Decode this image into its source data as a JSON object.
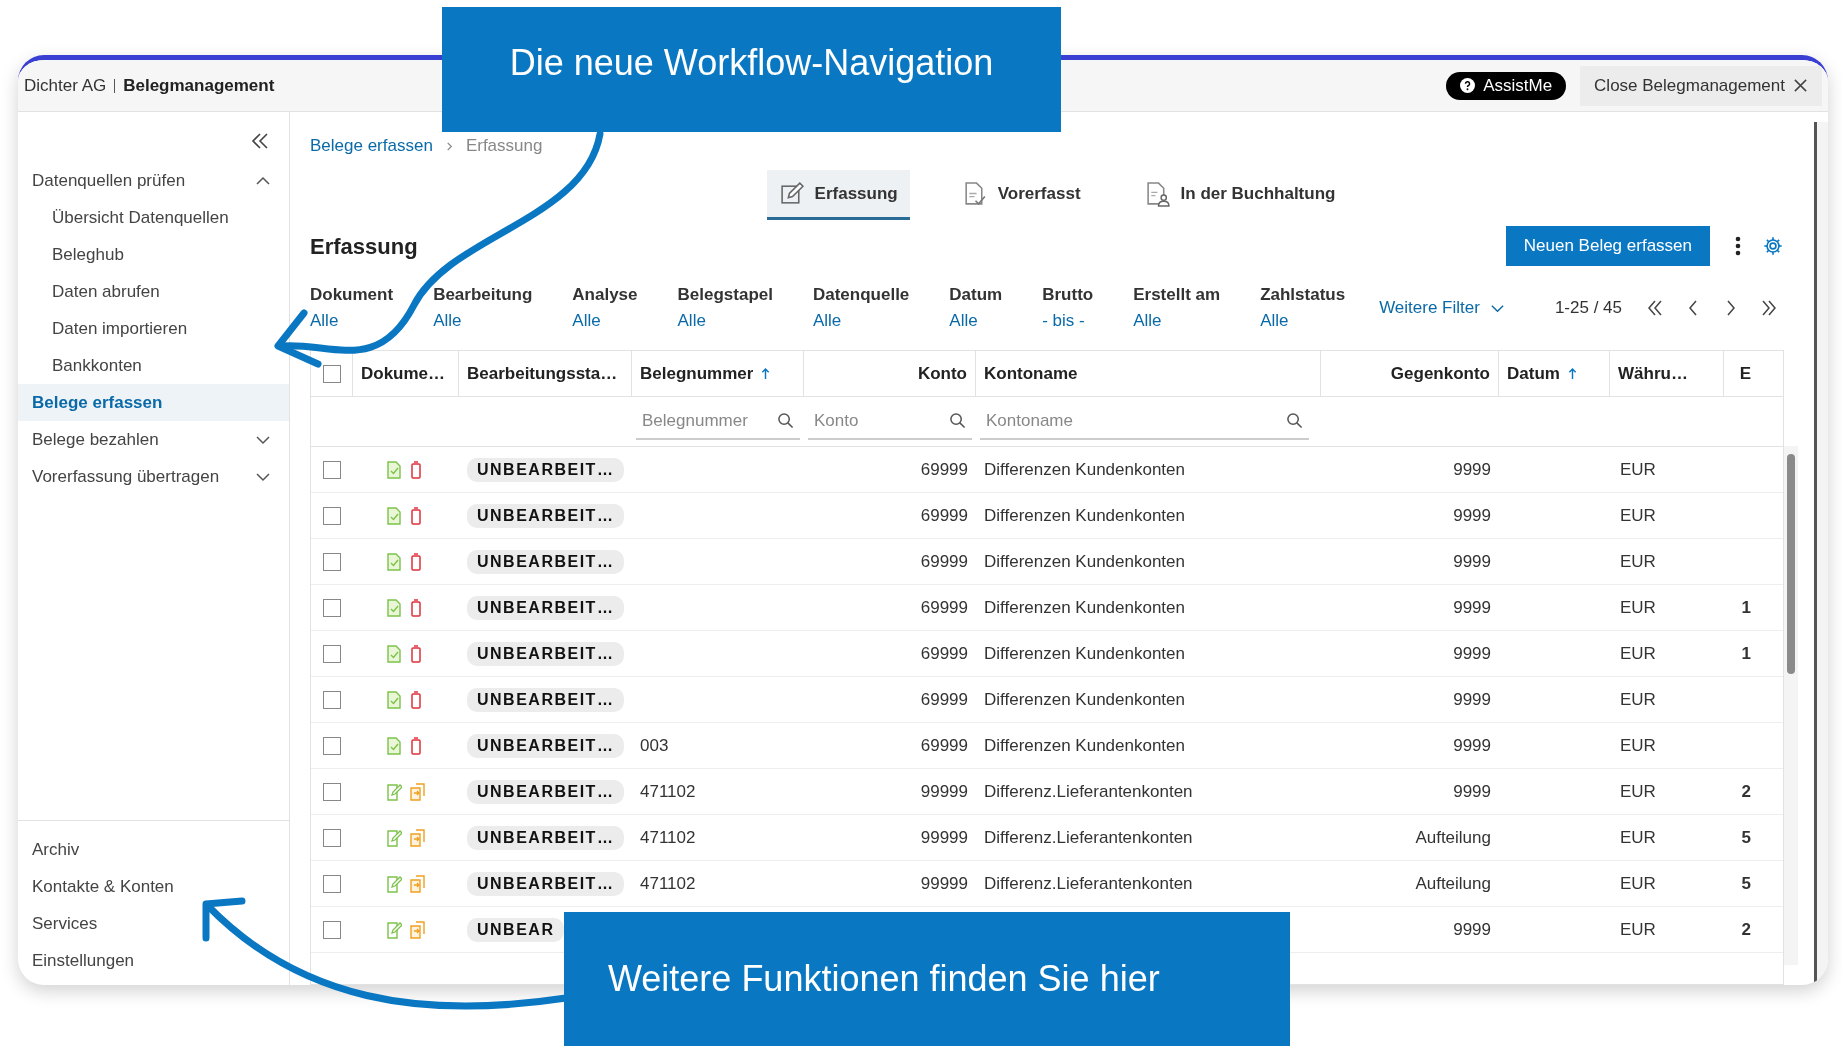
{
  "header": {
    "company": "Dichter AG",
    "app_title": "Belegmanagement",
    "assist_button": "AssistMe",
    "close_button": "Close Belegmanagement"
  },
  "sidebar": {
    "items": [
      {
        "label": "Datenquellen prüfen",
        "selected": false,
        "expanded": true,
        "children": [
          {
            "label": "Übersicht Datenquellen",
            "selected": false
          },
          {
            "label": "Beleghub",
            "selected": false
          },
          {
            "label": "Daten abrufen",
            "selected": false
          },
          {
            "label": "Daten importieren",
            "selected": false
          },
          {
            "label": "Bankkonten",
            "selected": false
          }
        ]
      },
      {
        "label": "Belege erfassen",
        "selected": true
      },
      {
        "label": "Belege bezahlen",
        "selected": false,
        "expanded": false
      },
      {
        "label": "Vorerfassung übertragen",
        "selected": false,
        "expanded": false
      }
    ],
    "bottom_items": [
      "Archiv",
      "Kontakte & Konten",
      "Services",
      "Einstellungen"
    ]
  },
  "breadcrumb": [
    "Belege erfassen",
    "Erfassung"
  ],
  "tabs": [
    {
      "label": "Erfassung",
      "selected": true,
      "kind": "edit"
    },
    {
      "label": "Vorerfasst",
      "selected": false,
      "kind": "check"
    },
    {
      "label": "In der Buchhaltung",
      "selected": false,
      "kind": "person"
    }
  ],
  "page_title": "Erfassung",
  "primary_button": "Neuen Beleg erfassen",
  "filters": [
    {
      "label": "Dokument",
      "value": "Alle"
    },
    {
      "label": "Bearbeitung",
      "value": "Alle"
    },
    {
      "label": "Analyse",
      "value": "Alle"
    },
    {
      "label": "Belegstapel",
      "value": "Alle"
    },
    {
      "label": "Datenquelle",
      "value": "Alle"
    },
    {
      "label": "Datum",
      "value": "Alle"
    },
    {
      "label": "Brutto",
      "value": "- bis -"
    },
    {
      "label": "Erstellt am",
      "value": "Alle"
    },
    {
      "label": "Zahlstatus",
      "value": "Alle"
    }
  ],
  "more_filters": "Weitere Filter",
  "pagination": "1-25 / 45",
  "table": {
    "select_all": {
      "checked": false
    },
    "columns": [
      {
        "label": "Dokume…",
        "sorted": false
      },
      {
        "label": "Bearbeitungssta…",
        "sorted": false
      },
      {
        "label": "Belegnummer",
        "sorted": true
      },
      {
        "label": "Konto",
        "sorted": false
      },
      {
        "label": "Kontoname",
        "sorted": false
      },
      {
        "label": "Gegenkonto",
        "sorted": false
      },
      {
        "label": "Datum",
        "sorted": true
      },
      {
        "label": "Währu…",
        "sorted": false
      },
      {
        "label": "E",
        "sorted": false
      }
    ],
    "search_fields": [
      {
        "placeholder": "Belegnummer"
      },
      {
        "placeholder": "Konto"
      },
      {
        "placeholder": "Kontoname"
      }
    ],
    "rows": [
      {
        "checked": false,
        "kind": "upload",
        "status": "UNBEARBEIT…",
        "konto": "69999",
        "kontoname": "Differenzen Kundenkonten",
        "gegenkonto": "9999",
        "currency": "EUR"
      },
      {
        "checked": false,
        "kind": "upload",
        "status": "UNBEARBEIT…",
        "konto": "69999",
        "kontoname": "Differenzen Kundenkonten",
        "gegenkonto": "9999",
        "currency": "EUR"
      },
      {
        "checked": false,
        "kind": "upload",
        "status": "UNBEARBEIT…",
        "konto": "69999",
        "kontoname": "Differenzen Kundenkonten",
        "gegenkonto": "9999",
        "currency": "EUR"
      },
      {
        "checked": false,
        "kind": "upload",
        "status": "UNBEARBEIT…",
        "konto": "69999",
        "kontoname": "Differenzen Kundenkonten",
        "gegenkonto": "9999",
        "currency": "EUR",
        "column_10": "1"
      },
      {
        "checked": false,
        "kind": "upload",
        "status": "UNBEARBEIT…",
        "konto": "69999",
        "kontoname": "Differenzen Kundenkonten",
        "gegenkonto": "9999",
        "currency": "EUR",
        "column_10": "1"
      },
      {
        "checked": false,
        "kind": "upload",
        "status": "UNBEARBEIT…",
        "konto": "69999",
        "kontoname": "Differenzen Kundenkonten",
        "gegenkonto": "9999",
        "currency": "EUR"
      },
      {
        "checked": false,
        "kind": "upload",
        "status": "UNBEARBEIT…",
        "belegnummer": "003",
        "konto": "69999",
        "kontoname": "Differenzen Kundenkonten",
        "gegenkonto": "9999",
        "currency": "EUR"
      },
      {
        "checked": false,
        "kind": "edit",
        "status": "UNBEARBEIT…",
        "belegnummer": "471102",
        "konto": "99999",
        "kontoname": "Differenz.Lieferantenkonten",
        "gegenkonto": "9999",
        "currency": "EUR",
        "column_10": "2"
      },
      {
        "checked": false,
        "kind": "edit",
        "status": "UNBEARBEIT…",
        "belegnummer": "471102",
        "konto": "99999",
        "kontoname": "Differenz.Lieferantenkonten",
        "gegenkonto": "Aufteilung",
        "currency": "EUR",
        "column_10": "5"
      },
      {
        "checked": false,
        "kind": "edit",
        "status": "UNBEARBEIT…",
        "belegnummer": "471102",
        "konto": "99999",
        "kontoname": "Differenz.Lieferantenkonten",
        "gegenkonto": "Aufteilung",
        "currency": "EUR",
        "column_10": "5"
      },
      {
        "checked": false,
        "kind": "edit",
        "status": "UNBEAR",
        "gegenkonto": "9999",
        "currency": "EUR",
        "column_10": "2"
      }
    ]
  },
  "callouts": [
    {
      "text": "Die neue Workflow-Navigation"
    },
    {
      "text": "Weitere Funktionen finden Sie hier"
    }
  ]
}
